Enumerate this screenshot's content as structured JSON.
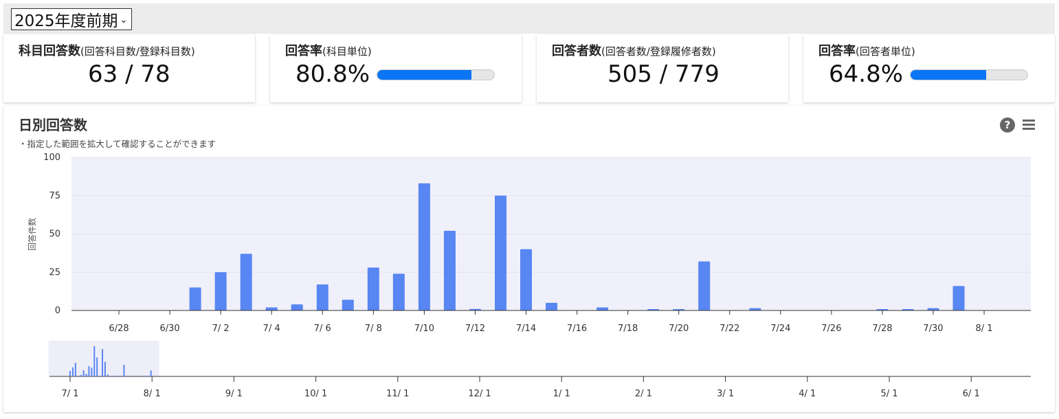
{
  "term": {
    "selected": "2025年度前期"
  },
  "cards": [
    {
      "title": "科目回答数",
      "subtitle": "(回答科目数/登録科目数)",
      "value": "63 / 78"
    },
    {
      "title": "回答率",
      "subtitle": "(科目単位)",
      "value": "80.8%",
      "progress": 0.808
    },
    {
      "title": "回答者数",
      "subtitle": "(回答者数/登録履修者数)",
      "value": "505 / 779"
    },
    {
      "title": "回答率",
      "subtitle": "(回答者単位)",
      "value": "64.8%",
      "progress": 0.648
    }
  ],
  "chart": {
    "title": "日別回答数",
    "subtitle": "・指定した範囲を拡大して確認することができます",
    "help_icon": "question-circle-icon",
    "menu_icon": "hamburger-menu-icon"
  },
  "chart_data": {
    "type": "bar",
    "ylabel": "回答件数",
    "ylim": [
      0,
      100
    ],
    "yticks": [
      "0",
      "25",
      "50",
      "75",
      "100"
    ],
    "grid": true,
    "bar_color": "#5886f2",
    "x": [
      "6/27",
      "6/28",
      "6/29",
      "6/30",
      "7/1",
      "7/2",
      "7/3",
      "7/4",
      "7/5",
      "7/6",
      "7/7",
      "7/8",
      "7/9",
      "7/10",
      "7/11",
      "7/12",
      "7/13",
      "7/14",
      "7/15",
      "7/16",
      "7/17",
      "7/18",
      "7/19",
      "7/20",
      "7/21",
      "7/22",
      "7/23",
      "7/24",
      "7/25",
      "7/26",
      "7/27",
      "7/28",
      "7/29",
      "7/30",
      "7/31",
      "8/1",
      "8/2"
    ],
    "values": [
      0,
      0,
      0,
      0,
      15,
      25,
      37,
      2,
      4,
      17,
      7,
      28,
      24,
      83,
      52,
      1,
      75,
      40,
      5,
      0,
      2,
      0,
      0.5,
      0.5,
      32,
      0,
      1.5,
      0,
      0,
      0,
      0,
      0.5,
      0.5,
      1.5,
      16,
      0,
      0
    ],
    "xticks": [
      "6/28",
      "6/30",
      "7/ 2",
      "7/ 4",
      "7/ 6",
      "7/ 8",
      "7/10",
      "7/12",
      "7/14",
      "7/16",
      "7/18",
      "7/20",
      "7/22",
      "7/24",
      "7/26",
      "7/28",
      "7/30",
      "8/ 1"
    ],
    "navigator": {
      "xticks": [
        "7/ 1",
        "8/ 1",
        "9/ 1",
        "10/ 1",
        "11/ 1",
        "12/ 1",
        "1/ 1",
        "2/ 1",
        "3/ 1",
        "4/ 1",
        "5/ 1",
        "6/ 1"
      ],
      "range_start": "6/27",
      "range_end": "8/2"
    }
  }
}
